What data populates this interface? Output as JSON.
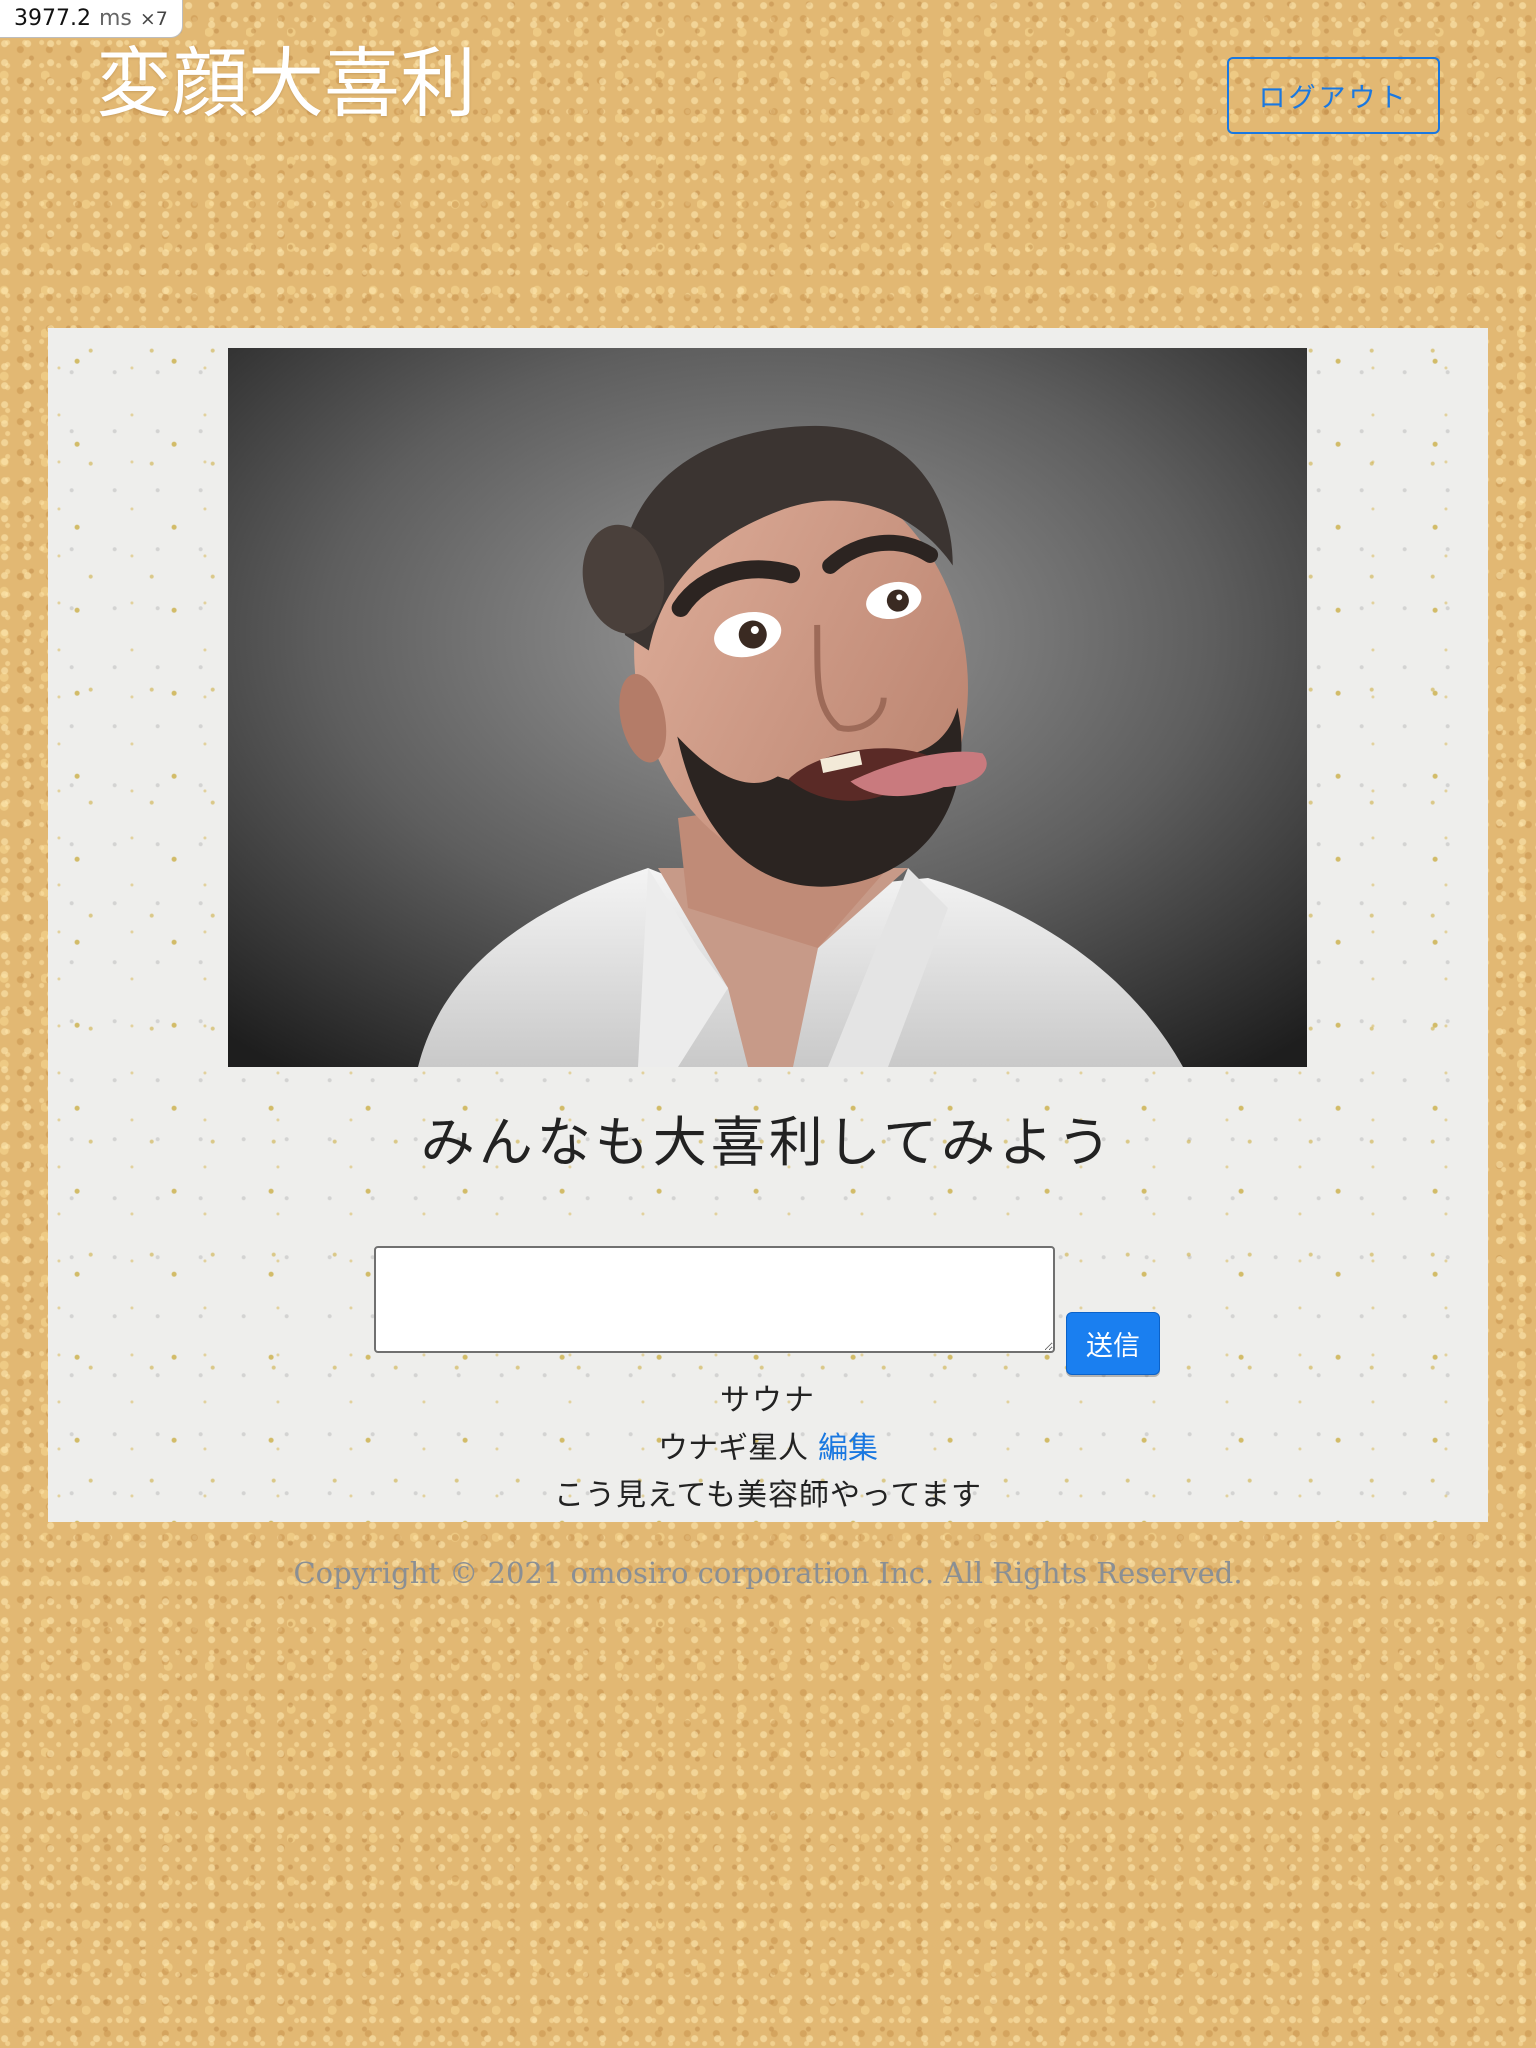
{
  "perf_badge": {
    "value": "3977.2",
    "unit": "ms",
    "multiplier": "×7"
  },
  "header": {
    "title": "変顔大喜利",
    "logout_label": "ログアウト"
  },
  "main": {
    "photo_description_icon": "funny-face-photo",
    "prompt": "みんなも大喜利してみよう",
    "form": {
      "textarea_value": "",
      "submit_label": "送信"
    },
    "answer": {
      "text": "サウナ",
      "author": "ウナギ星人",
      "edit_label": "編集",
      "bio": "こう見えても美容師やってます"
    }
  },
  "footer": {
    "copyright": "Copyright © 2021 omosiro corporation Inc. All Rights Reserved."
  },
  "colors": {
    "accent": "#1a78e0",
    "submit_bg": "#1a7ff0",
    "cork": "#e2b873",
    "card": "#eeeeec",
    "footer_text": "#8a8f94"
  }
}
